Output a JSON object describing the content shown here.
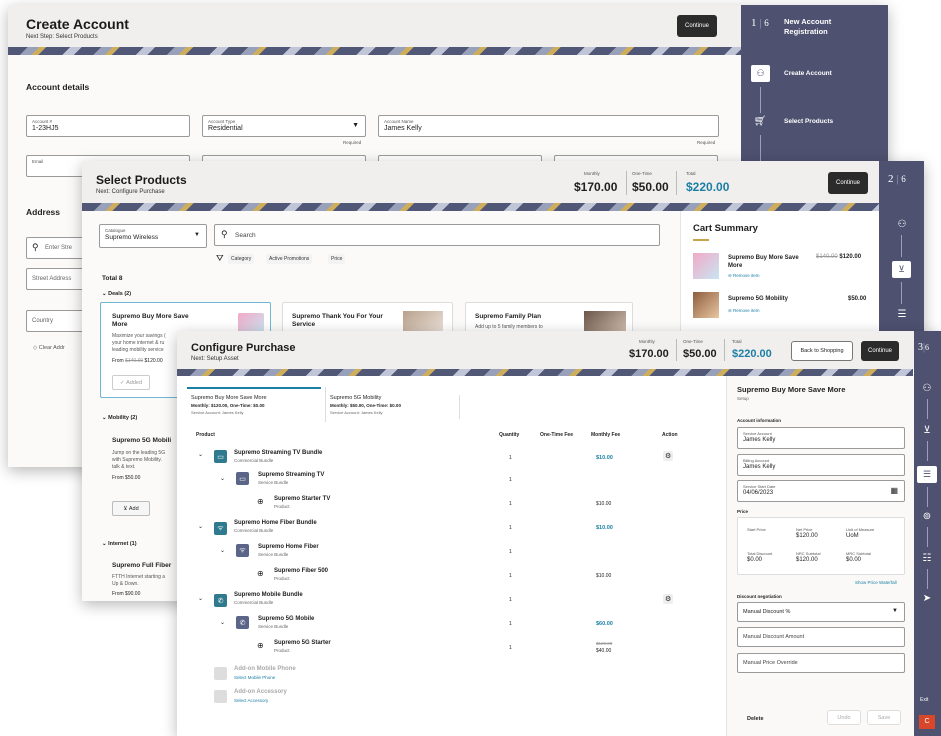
{
  "create": {
    "title": "Create Account",
    "subtitle": "Next Step: Select Products",
    "continue": "Continue",
    "section": "Account details",
    "account_no": {
      "label": "Account #",
      "value": "1-23HJ5"
    },
    "account_type": {
      "label": "Account Type",
      "value": "Residential",
      "required": "Required"
    },
    "account_name": {
      "label": "Account Name",
      "value": "James Kelly",
      "required": "Required"
    },
    "email_label": "Email",
    "address_title": "Address",
    "address_search_placeholder": "Enter Stre",
    "street_placeholder": "Street Address",
    "country_placeholder": "Country",
    "clear_link": "Clear Addr",
    "rail": {
      "step": "1",
      "total": "6",
      "title_line1": "New Account",
      "title_line2": "Registration",
      "step1": "Create Account",
      "step2": "Select Products"
    }
  },
  "select": {
    "title": "Select Products",
    "subtitle": "Next: Configure Purchase",
    "monthly_label": "Monthly",
    "monthly": "$170.00",
    "onetime_label": "One-Time",
    "onetime": "$50.00",
    "total_label": "Total",
    "total": "$220.00",
    "continue": "Continue",
    "catalogue_label": "Catalogue",
    "catalogue": "Supremo Wireless",
    "search_placeholder": "Search",
    "filters": [
      "Category",
      "Active Promotions",
      "Price"
    ],
    "total_count": "Total 8",
    "deals_group": "Deals (2)",
    "deal1": {
      "name_line1": "Supremo Buy More Save",
      "name_line2": "More",
      "desc1": "Maximize your savings (",
      "desc2": "your home internet & ru",
      "desc3": "leading mobility service",
      "from": "From",
      "old": "$140.00",
      "price": "$120.00",
      "status": "Added"
    },
    "deal2": {
      "name_line1": "Supremo Thank You For Your",
      "name_line2": "Service"
    },
    "deal3": {
      "name": "Supremo Family Plan",
      "desc": "Add up to 5 family members to"
    },
    "mobility_group": "Mobility (2)",
    "mob1": {
      "name": "Supremo 5G Mobili",
      "desc1": "Jump on the leading 5G",
      "desc2": "with Supremo Mobility.",
      "desc3": "talk & text.",
      "price": "From $50.00",
      "add": "Add"
    },
    "internet_group": "Internet (1)",
    "int1": {
      "name": "Supremo Full Fiber",
      "desc1": "FTTH Internet starting a",
      "desc2": "Up & Down.",
      "price": "From $90.00"
    },
    "cart": {
      "title": "Cart Summary",
      "item1": {
        "name_line1": "Supremo Buy More Save",
        "name_line2": "More",
        "old": "$140.00",
        "price": "$120.00",
        "remove": "Remove item"
      },
      "item2": {
        "name": "Supremo 5G Mobility",
        "price": "$50.00",
        "remove": "Remove item"
      }
    },
    "rail": {
      "step": "2",
      "total": "6"
    }
  },
  "config": {
    "title": "Configure Purchase",
    "subtitle": "Next: Setup Asset",
    "monthly_label": "Monthly",
    "monthly": "$170.00",
    "onetime_label": "One-Time",
    "onetime": "$50.00",
    "total_label": "Total",
    "total": "$220.00",
    "back": "Back to Shopping",
    "continue": "Continue",
    "tabs": [
      {
        "name": "Supremo Buy More Save More",
        "price": "Monthly: $120.00, One-Time: $0.00",
        "acct": "Service Account: James Kelly"
      },
      {
        "name": "Supremo 5G Mobility",
        "price": "Monthly: $50.00, One-Time: $0.00",
        "acct": "Service Account: James Kelly"
      }
    ],
    "columns": {
      "product": "Product",
      "quantity": "Quantity",
      "onetime": "One-Time Fee",
      "monthly": "Monthly Fee",
      "action": "Action"
    },
    "rows": [
      {
        "name": "Supremo Streaming TV Bundle",
        "type": "Commercial Bundle",
        "qty": "1",
        "onetime": "",
        "monthly": "$10.00"
      },
      {
        "name": "Supremo Streaming TV",
        "type": "Service Bundle",
        "qty": "1",
        "onetime": "",
        "monthly": ""
      },
      {
        "name": "Supremo Starter TV",
        "type": "Product",
        "qty": "1",
        "onetime": "",
        "monthly": "$10.00"
      },
      {
        "name": "Supremo Home Fiber Bundle",
        "type": "Commercial Bundle",
        "qty": "1",
        "onetime": "",
        "monthly": "$10.00"
      },
      {
        "name": "Supremo Home Fiber",
        "type": "Service Bundle",
        "qty": "1",
        "onetime": "",
        "monthly": ""
      },
      {
        "name": "Supremo Fiber 500",
        "type": "Product",
        "qty": "1",
        "onetime": "",
        "monthly": "$10.00"
      },
      {
        "name": "Supremo Mobile Bundle",
        "type": "Commercial Bundle",
        "qty": "1",
        "onetime": "",
        "monthly": ""
      },
      {
        "name": "Supremo 5G Mobile",
        "type": "Service Bundle",
        "qty": "1",
        "onetime": "",
        "monthly": "$60.00"
      },
      {
        "name": "Supremo 5G Starter",
        "type": "Product",
        "qty": "1",
        "onetime": "",
        "monthly_old": "$120.00",
        "monthly": "$40.00"
      }
    ],
    "addons": [
      {
        "name": "Add-on Mobile Phone",
        "link": "Select Mobile Phone"
      },
      {
        "name": "Add-on Accessory",
        "link": "Select Accessory"
      }
    ],
    "panel": {
      "title": "Supremo Buy More Save More",
      "sub": "Setup",
      "acct_section": "Account information",
      "service_acct_label": "Service Account",
      "service_acct": "James Kelly",
      "billing_acct_label": "Billing Account",
      "billing_acct": "James Kelly",
      "start_label": "Service Start Date",
      "start": "04/06/2023",
      "price_section": "Price",
      "start_price_label": "Start Price",
      "net_price_label": "Net Price",
      "net_price": "$120.00",
      "uom_label": "Unit of Measure",
      "uom": "UoM",
      "total_disc_label": "Total Discount",
      "total_disc": "$0.00",
      "nrc_label": "NRC Subtotal",
      "nrc": "$120.00",
      "mrc_label": "MRC Subtotal",
      "mrc": "$0.00",
      "show_waterfall": "Show Price Waterfall",
      "disc_section": "Discount negotiation",
      "manual_pct": "Manual Discount %",
      "manual_amt": "Manual Discount Amount",
      "manual_override": "Manual Price Override",
      "delete": "Delete",
      "undo": "Undo",
      "save": "Save"
    },
    "rail": {
      "step": "3",
      "total": "6",
      "exit": "Exit"
    }
  },
  "colors": {
    "rail": "#4e5170",
    "accent": "#1b7fa5",
    "teal_icon": "#2f7a8e",
    "slate_icon": "#5b6588"
  }
}
